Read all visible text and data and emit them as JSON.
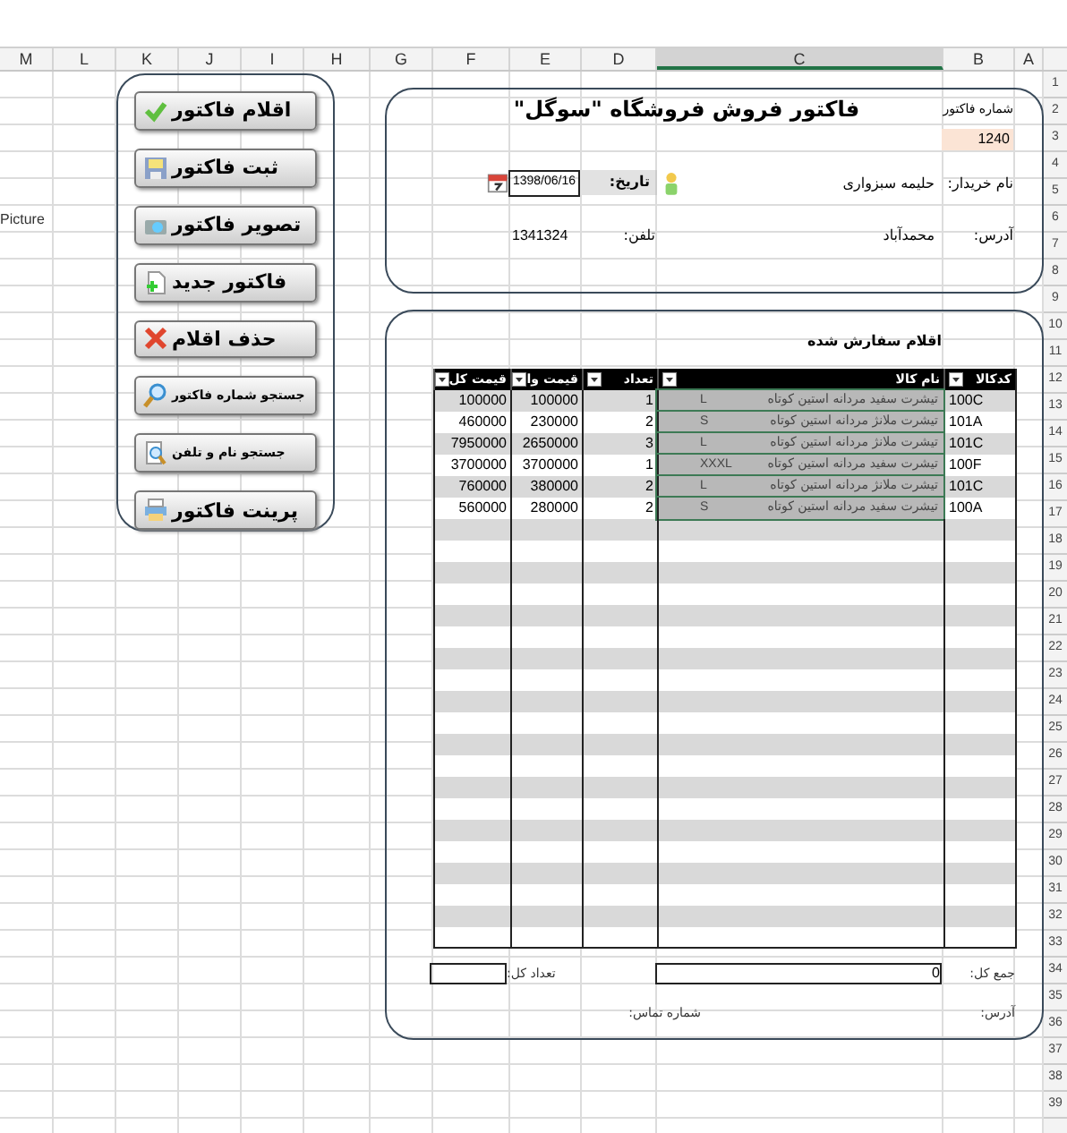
{
  "columns": [
    {
      "label": "A",
      "selected": false
    },
    {
      "label": "B",
      "selected": false
    },
    {
      "label": "C",
      "selected": true
    },
    {
      "label": "D",
      "selected": false
    },
    {
      "label": "E",
      "selected": false
    },
    {
      "label": "F",
      "selected": false
    },
    {
      "label": "G",
      "selected": false
    },
    {
      "label": "H",
      "selected": false
    },
    {
      "label": "I",
      "selected": false
    },
    {
      "label": "J",
      "selected": false
    },
    {
      "label": "K",
      "selected": false
    },
    {
      "label": "L",
      "selected": false
    },
    {
      "label": "M",
      "selected": false
    }
  ],
  "row_headers": [
    "1",
    "2",
    "3",
    "4",
    "5",
    "6",
    "7",
    "8",
    "9",
    "10",
    "11",
    "12",
    "13",
    "14",
    "15",
    "16",
    "17",
    "18",
    "19",
    "20",
    "21",
    "22",
    "23",
    "24",
    "25",
    "26",
    "27",
    "28",
    "29",
    "30",
    "31",
    "32",
    "33",
    "34",
    "35",
    "36",
    "37",
    "38",
    "39"
  ],
  "side_text": "Picture",
  "buttons": [
    {
      "label": "اقلام فاکتور",
      "kind": "check"
    },
    {
      "label": "ثبت فاکتور",
      "kind": "save"
    },
    {
      "label": "تصویر فاکتور",
      "kind": "camera"
    },
    {
      "label": "فاکتور جدید",
      "kind": "new"
    },
    {
      "label": "حذف اقلام",
      "kind": "delete"
    },
    {
      "label": "جستجو شماره فاکتور",
      "kind": "search"
    },
    {
      "label": "جستجو نام و تلفن",
      "kind": "docsearch"
    },
    {
      "label": "پرینت فاکتور",
      "kind": "print"
    }
  ],
  "invoice": {
    "title": "فاکتور فروش فروشگاه \"سوگل\"",
    "number_label": "شماره فاکتور",
    "number": "1240",
    "buyer_label": "نام خریدار:",
    "buyer": "حلیمه سبزواری",
    "date_label": "تاریخ:",
    "date": "1398/06/16",
    "address_label": "آدرس:",
    "address": "محمدآباد",
    "phone_label": "تلفن:",
    "phone": "1341324"
  },
  "items": {
    "title": "اقلام سفارش شده",
    "columns": [
      "کدکالا",
      "نام کالا",
      "تعداد",
      "قیمت وا",
      "قیمت کل"
    ],
    "rows": [
      {
        "code": "100C",
        "name": "تیشرت سفید مردانه استین کوتاه",
        "size": "L",
        "qty": "1",
        "unit_price": "100000",
        "total": "100000",
        "selected": true
      },
      {
        "code": "101A",
        "name": "تیشرت ملانژ مردانه استین کوتاه",
        "size": "S",
        "qty": "2",
        "unit_price": "230000",
        "total": "460000",
        "selected": true
      },
      {
        "code": "101C",
        "name": "تیشرت ملانژ مردانه استین کوتاه",
        "size": "L",
        "qty": "3",
        "unit_price": "2650000",
        "total": "7950000",
        "selected": true
      },
      {
        "code": "100F",
        "name": "تیشرت سفید مردانه استین کوتاه",
        "size": "XXXL",
        "qty": "1",
        "unit_price": "3700000",
        "total": "3700000",
        "selected": true
      },
      {
        "code": "101C",
        "name": "تیشرت ملانژ مردانه استین کوتاه",
        "size": "L",
        "qty": "2",
        "unit_price": "380000",
        "total": "760000",
        "selected": true
      },
      {
        "code": "100A",
        "name": "تیشرت سفید مردانه استین کوتاه",
        "size": "S",
        "qty": "2",
        "unit_price": "280000",
        "total": "560000",
        "selected": true
      }
    ]
  },
  "totals": {
    "sum_label": "جمع کل:",
    "sum": "0",
    "count_label": "تعداد کل:",
    "address_label": "آدرس:",
    "phone_label": "شماره تماس:"
  }
}
